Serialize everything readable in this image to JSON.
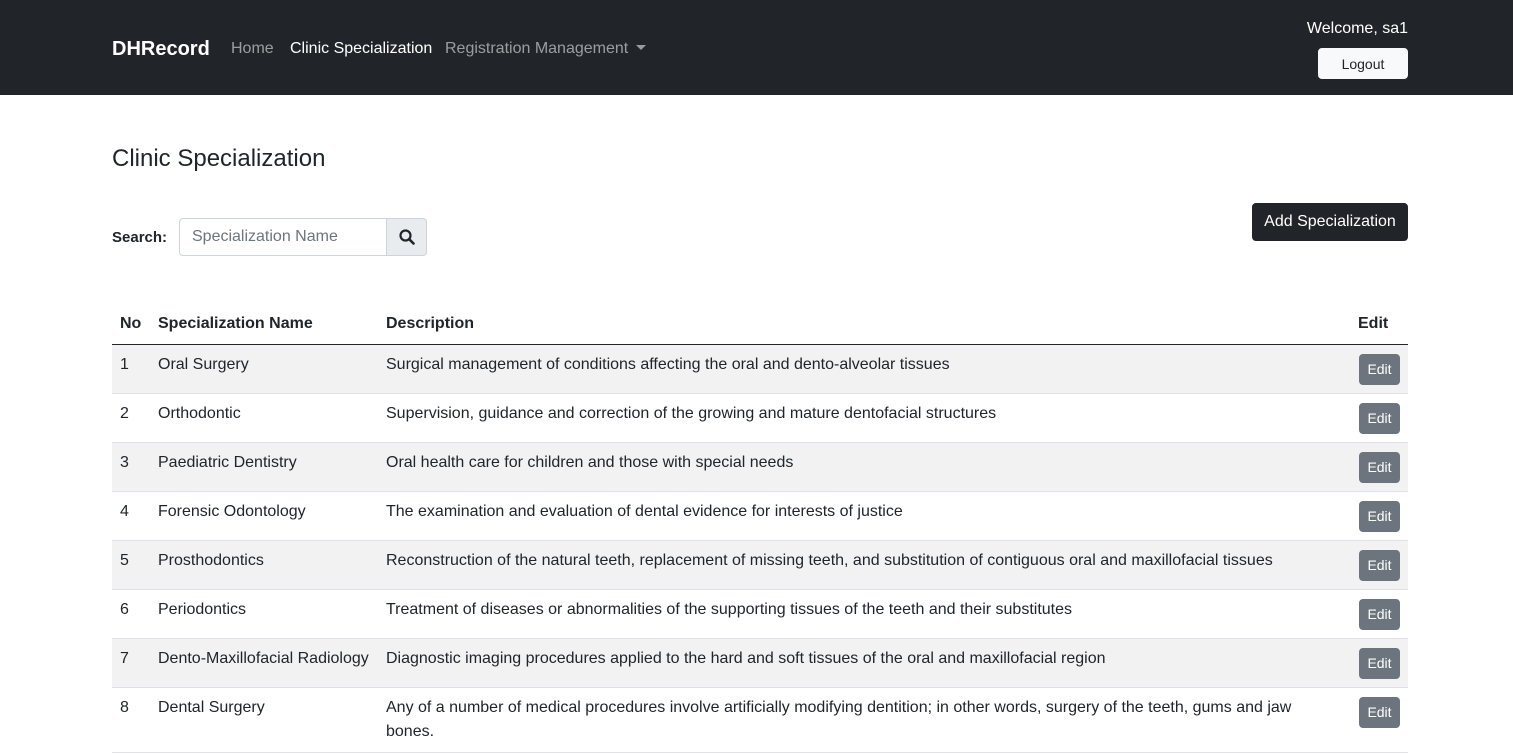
{
  "navbar": {
    "brand": "DHRecord",
    "links": [
      {
        "label": "Home"
      },
      {
        "label": "Clinic Specialization"
      },
      {
        "label": "Registration Management"
      }
    ],
    "welcome": "Welcome, sa1",
    "logout_label": "Logout"
  },
  "page": {
    "title": "Clinic Specialization",
    "search_label": "Search:",
    "search_placeholder": "Specialization Name",
    "search_value": "",
    "add_button_label": "Add Specialization"
  },
  "table": {
    "headers": [
      "No",
      "Specialization Name",
      "Description",
      "Edit"
    ],
    "edit_label": "Edit",
    "rows": [
      {
        "no": "1",
        "name": "Oral Surgery",
        "description": "Surgical management of conditions affecting the oral and dento-alveolar tissues"
      },
      {
        "no": "2",
        "name": "Orthodontic",
        "description": "Supervision, guidance and correction of the growing and mature dentofacial structures"
      },
      {
        "no": "3",
        "name": "Paediatric Dentistry",
        "description": "Oral health care for children and those with special needs"
      },
      {
        "no": "4",
        "name": "Forensic Odontology",
        "description": "The examination and evaluation of dental evidence for interests of justice"
      },
      {
        "no": "5",
        "name": "Prosthodontics",
        "description": "Reconstruction of the natural teeth, replacement of missing teeth, and substitution of contiguous oral and maxillofacial tissues"
      },
      {
        "no": "6",
        "name": "Periodontics",
        "description": "Treatment of diseases or abnormalities of the supporting tissues of the teeth and their substitutes"
      },
      {
        "no": "7",
        "name": "Dento-Maxillofacial Radiology",
        "description": "Diagnostic imaging procedures applied to the hard and soft tissues of the oral and maxillofacial region"
      },
      {
        "no": "8",
        "name": "Dental Surgery",
        "description": "Any of a number of medical procedures involve artificially modifying dentition; in other words, surgery of the teeth, gums and jaw bones."
      }
    ]
  },
  "colors": {
    "navbar_bg": "#212529",
    "stripe": "#f2f2f2",
    "edit_button": "#6c757d"
  }
}
